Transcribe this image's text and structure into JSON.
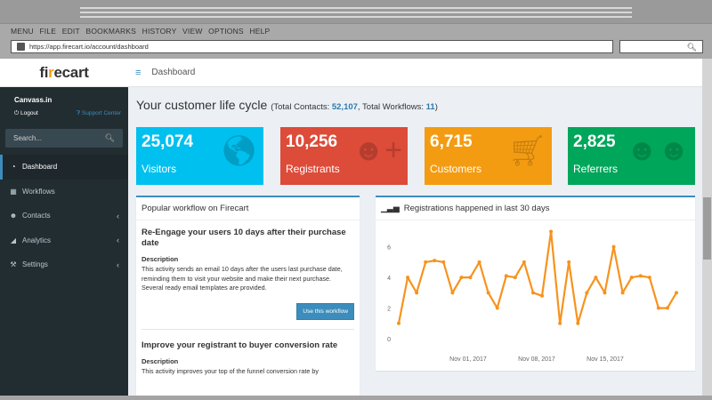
{
  "browser": {
    "menu": [
      "MENU",
      "FILE",
      "EDIT",
      "BOOKMARKS",
      "HISTORY",
      "VIEW",
      "OPTIONS",
      "HELP"
    ],
    "url": "https://app.firecart.io/account/dashboard"
  },
  "brand": {
    "name_main": "fi",
    "name_dot": "r",
    "name_rest": "ecart"
  },
  "user": {
    "name": "Canvass.in",
    "logout": "Logout",
    "support": "Support Center"
  },
  "sidebar": {
    "search_placeholder": "Search...",
    "items": [
      {
        "label": "Dashboard",
        "icon": "dashboard-icon",
        "active": true,
        "chevron": ""
      },
      {
        "label": "Workflows",
        "icon": "grid-icon",
        "active": false,
        "chevron": ""
      },
      {
        "label": "Contacts",
        "icon": "users-icon",
        "active": false,
        "chevron": "‹"
      },
      {
        "label": "Analytics",
        "icon": "area-chart-icon",
        "active": false,
        "chevron": "‹"
      },
      {
        "label": "Settings",
        "icon": "wrench-icon",
        "active": false,
        "chevron": "‹"
      }
    ]
  },
  "topbar": {
    "title": "Dashboard"
  },
  "header": {
    "title": "Your customer life cycle",
    "contacts_prefix": "(Total Contacts: ",
    "contacts_value": "52,107",
    "workflows_prefix": ", Total Workflows: ",
    "workflows_value": "11",
    "suffix": ")"
  },
  "stats": [
    {
      "value": "25,074",
      "label": "Visitors",
      "color": "#00c0ef",
      "icon": "globe-icon"
    },
    {
      "value": "10,256",
      "label": "Registrants",
      "color": "#dd4b39",
      "icon": "user-plus-icon"
    },
    {
      "value": "6,715",
      "label": "Customers",
      "color": "#f39c12",
      "icon": "cart-icon"
    },
    {
      "value": "2,825",
      "label": "Referrers",
      "color": "#00a65a",
      "icon": "group-icon"
    }
  ],
  "workflow_panel": {
    "title": "Popular workflow on Firecart",
    "items": [
      {
        "title": "Re-Engage your users 10 days after their purchase date",
        "desc_label": "Description",
        "desc": "This activity sends an email 10 days after the users last purchase date, reminding them to visit your website and make their next purchase. Several ready email templates are provided.",
        "button": "Use this workflow"
      },
      {
        "title": "Improve your registrant to buyer conversion rate",
        "desc_label": "Description",
        "desc": "This activity improves your top of the funnel conversion rate by"
      }
    ]
  },
  "chart_panel": {
    "title": "Registrations happened in last 30 days",
    "icon": "bar-chart-icon"
  },
  "chart_data": {
    "type": "line",
    "title": "Registrations happened in last 30 days",
    "xlabel": "",
    "ylabel": "",
    "ylim": [
      0,
      7.2
    ],
    "yticks": [
      "0",
      "2",
      "4",
      "6"
    ],
    "xtick_labels": [
      "Nov 01, 2017",
      "Nov 08, 2017",
      "Nov 15, 2017"
    ],
    "series_color": "#f7931e",
    "values": [
      1,
      4,
      3,
      5,
      5.1,
      5,
      3,
      4,
      4,
      5,
      3,
      2,
      4.1,
      4,
      5,
      3,
      2.8,
      7,
      1,
      5,
      1,
      3,
      4,
      3,
      6,
      3,
      4,
      4.1,
      4,
      2,
      2,
      3
    ]
  }
}
